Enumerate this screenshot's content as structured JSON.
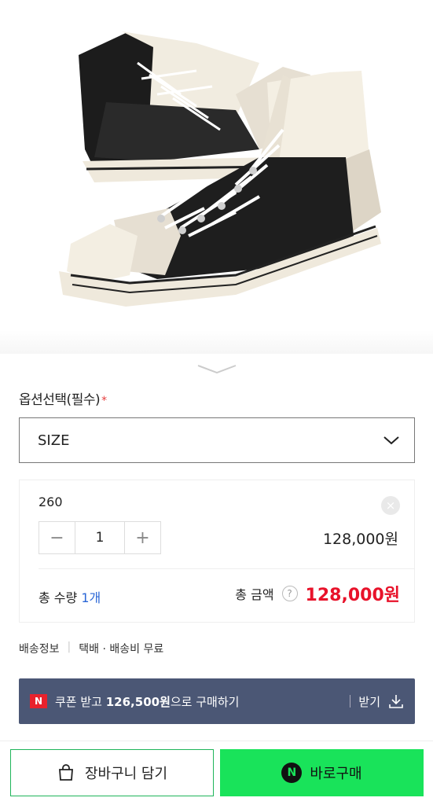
{
  "option": {
    "title": "옵션선택(필수)",
    "required_mark": "*",
    "select_label": "SIZE"
  },
  "item": {
    "size": "260",
    "remove_glyph": "×",
    "minus_glyph": "−",
    "quantity": "1",
    "plus_glyph": "+",
    "price": "128,000원"
  },
  "summary": {
    "qty_prefix": "총 수량",
    "qty_value": "1개",
    "amount_label": "총 금액",
    "help_glyph": "?",
    "total": "128,000원"
  },
  "shipping": {
    "label": "배송정보",
    "sep": "|",
    "value": "택배 · 배송비 무료"
  },
  "coupon": {
    "badge": "N",
    "text_prefix": "쿠폰 받고 ",
    "amount": "126,500원",
    "text_suffix": "으로 구매하기",
    "receive_label": "받기"
  },
  "actions": {
    "cart_label": "장바구니 담기",
    "buy_badge": "N",
    "buy_label": "바로구매"
  },
  "colors": {
    "accent_red": "#e8122a",
    "coupon_bg": "#4b5775",
    "npay_green": "#19e35a"
  }
}
